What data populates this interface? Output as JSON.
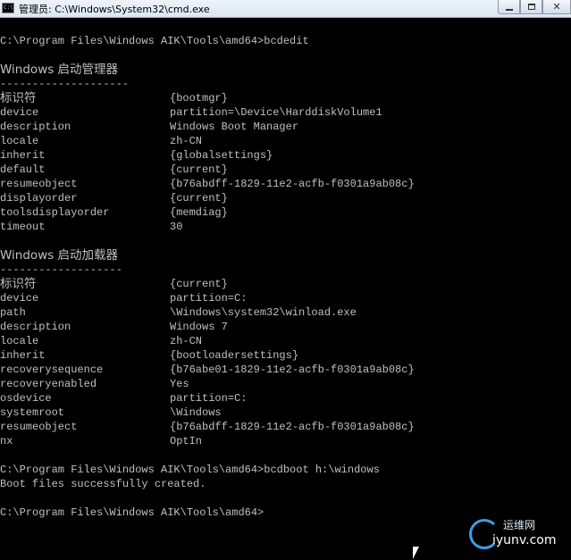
{
  "window": {
    "title": "管理员: C:\\Windows\\System32\\cmd.exe",
    "icon_text": "C:\\",
    "controls": {
      "minimize_icon": "minimize-icon",
      "maximize_icon": "maximize-icon",
      "close_icon": "close-icon"
    }
  },
  "console": {
    "prompt1": "C:\\Program Files\\Windows AIK\\Tools\\amd64>bcdedit",
    "boot_manager": {
      "heading": "Windows 启动管理器",
      "separator": "--------------------",
      "rows": [
        {
          "key": "标识符",
          "value": "{bootmgr}"
        },
        {
          "key": "device",
          "value": "partition=\\Device\\HarddiskVolume1"
        },
        {
          "key": "description",
          "value": "Windows Boot Manager"
        },
        {
          "key": "locale",
          "value": "zh-CN"
        },
        {
          "key": "inherit",
          "value": "{globalsettings}"
        },
        {
          "key": "default",
          "value": "{current}"
        },
        {
          "key": "resumeobject",
          "value": "{b76abdff-1829-11e2-acfb-f0301a9ab08c}"
        },
        {
          "key": "displayorder",
          "value": "{current}"
        },
        {
          "key": "toolsdisplayorder",
          "value": "{memdiag}"
        },
        {
          "key": "timeout",
          "value": "30"
        }
      ]
    },
    "boot_loader": {
      "heading": "Windows 启动加载器",
      "separator": "-------------------",
      "rows": [
        {
          "key": "标识符",
          "value": "{current}"
        },
        {
          "key": "device",
          "value": "partition=C:"
        },
        {
          "key": "path",
          "value": "\\Windows\\system32\\winload.exe"
        },
        {
          "key": "description",
          "value": "Windows 7"
        },
        {
          "key": "locale",
          "value": "zh-CN"
        },
        {
          "key": "inherit",
          "value": "{bootloadersettings}"
        },
        {
          "key": "recoverysequence",
          "value": "{b76abe01-1829-11e2-acfb-f0301a9ab08c}"
        },
        {
          "key": "recoveryenabled",
          "value": "Yes"
        },
        {
          "key": "osdevice",
          "value": "partition=C:"
        },
        {
          "key": "systemroot",
          "value": "\\Windows"
        },
        {
          "key": "resumeobject",
          "value": "{b76abdff-1829-11e2-acfb-f0301a9ab08c}"
        },
        {
          "key": "nx",
          "value": "OptIn"
        }
      ]
    },
    "prompt2": "C:\\Program Files\\Windows AIK\\Tools\\amd64>bcdboot h:\\windows",
    "result": "Boot files successfully created.",
    "prompt3": "C:\\Program Files\\Windows AIK\\Tools\\amd64>"
  },
  "watermark": {
    "top": "运维网",
    "bottom": "iyunv.com"
  },
  "colors": {
    "console_bg": "#000000",
    "console_text": "#c0c0c0",
    "titlebar": "#dbe6f2"
  }
}
